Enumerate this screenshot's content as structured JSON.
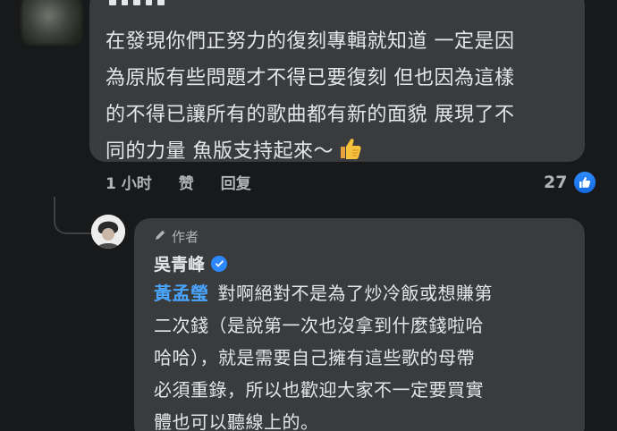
{
  "top_comment": {
    "lines": [
      "在發現你們正努力的復刻專輯就知道 一定是因",
      "為原版有些問題才不得已要復刻 但也因為這樣",
      "的不得已讓所有的歌曲都有新的面貌 展現了不",
      "同的力量  魚版支持起來～"
    ],
    "emoji": "thumbs-up",
    "time": "1 小时",
    "like_action": "赞",
    "reply_action": "回复",
    "reaction_count": "27",
    "reaction_icon": "like-icon",
    "like_color": "#1877f2"
  },
  "reply": {
    "author_badge": "作者",
    "author_badge_icon": "pen-icon",
    "name": "吳青峰",
    "verified_color": "#2d88ff",
    "mention": "黃孟瑩",
    "lines": [
      "對啊絕對不是為了炒冷飯或想賺第",
      "二次錢（是說第一次也沒拿到什麼錢啦哈",
      "哈哈），就是需要自己擁有這些歌的母帶",
      "必須重錄，所以也歡迎大家不一定要買實",
      "體也可以聽線上的。"
    ],
    "mention_color": "#4aa5ff"
  }
}
